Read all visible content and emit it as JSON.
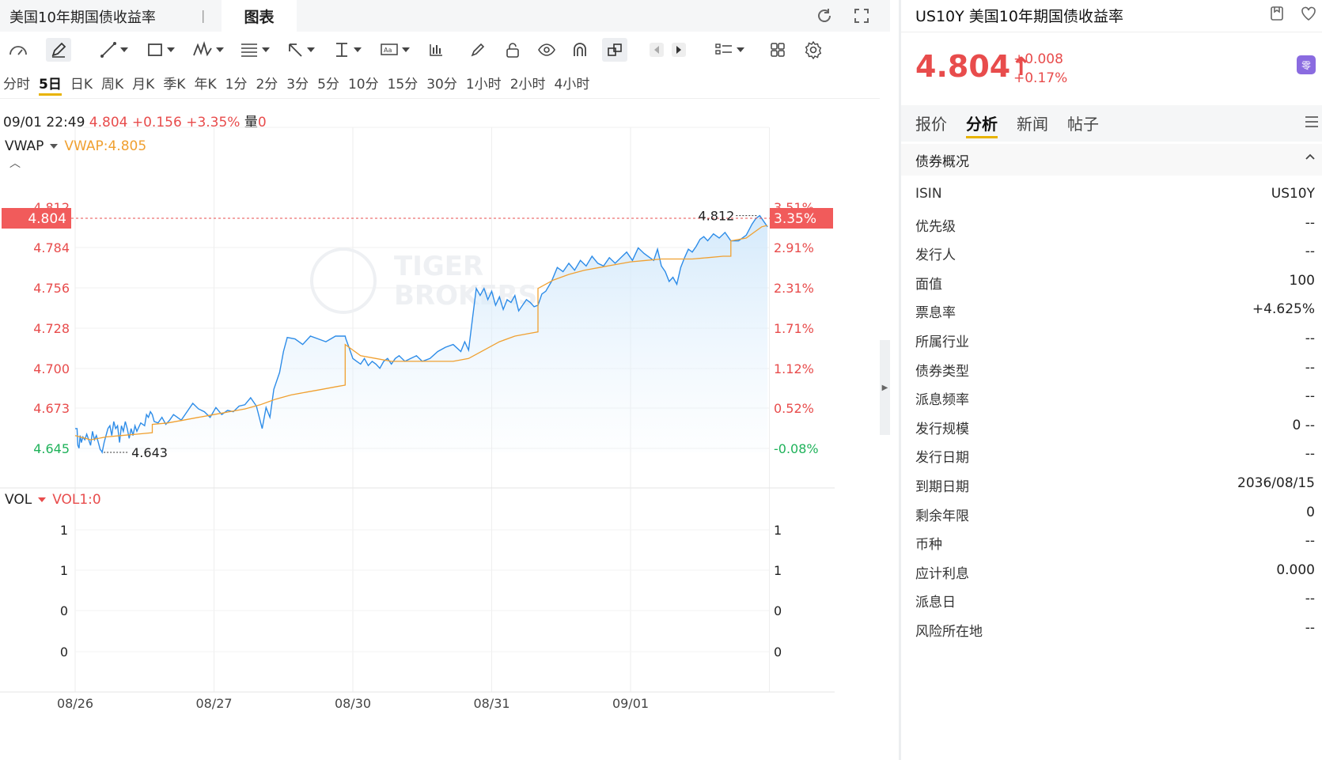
{
  "topbar": {
    "tab_name": "美国10年期国债收益率",
    "sep": "|",
    "chart_tab": "图表"
  },
  "periods": [
    "分时",
    "5日",
    "日K",
    "周K",
    "月K",
    "季K",
    "年K",
    "1分",
    "2分",
    "3分",
    "5分",
    "10分",
    "15分",
    "30分",
    "1小时",
    "2小时",
    "4小时"
  ],
  "active_period": "5日",
  "info_line": {
    "datetime": "09/01 22:49",
    "price": "4.804",
    "change": "+0.156",
    "change_pct": "+3.35%",
    "vol_label": "量",
    "vol_value": "0"
  },
  "indicators": {
    "vwap_label": "VWAP",
    "vwap_value": "VWAP:4.805",
    "vol_label": "VOL",
    "vol_value": "VOL1:0"
  },
  "watermark": {
    "line1": "TIGER",
    "line2": "BROKERS"
  },
  "chart_data": {
    "type": "line",
    "x_labels": [
      "08/26",
      "08/27",
      "08/30",
      "08/31",
      "09/01"
    ],
    "y_ticks": [
      "4.812",
      "4.784",
      "4.756",
      "4.728",
      "4.700",
      "4.673",
      "4.645"
    ],
    "pct_ticks": [
      "3.51%",
      "2.91%",
      "2.31%",
      "1.71%",
      "1.12%",
      "0.52%",
      "-0.08%"
    ],
    "last_price_label": "4.804",
    "last_pct_label": "3.35%",
    "high_label": "4.812",
    "low_label": "4.643",
    "ylim": [
      4.643,
      4.818
    ],
    "price_series": [
      [
        0.0,
        4.66
      ],
      [
        0.05,
        4.66
      ],
      [
        0.07,
        4.648
      ],
      [
        0.1,
        4.646
      ],
      [
        0.13,
        4.655
      ],
      [
        0.16,
        4.65
      ],
      [
        0.2,
        4.654
      ],
      [
        0.25,
        4.652
      ],
      [
        0.3,
        4.656
      ],
      [
        0.35,
        4.652
      ],
      [
        0.4,
        4.648
      ],
      [
        0.45,
        4.658
      ],
      [
        0.5,
        4.652
      ],
      [
        0.55,
        4.655
      ],
      [
        0.6,
        4.65
      ],
      [
        0.65,
        4.645
      ],
      [
        0.68,
        4.644
      ],
      [
        0.7,
        4.643
      ],
      [
        0.75,
        4.65
      ],
      [
        0.8,
        4.655
      ],
      [
        0.85,
        4.66
      ],
      [
        0.9,
        4.662
      ],
      [
        0.95,
        4.655
      ],
      [
        1.0,
        4.665
      ],
      [
        1.05,
        4.66
      ],
      [
        1.1,
        4.662
      ],
      [
        1.15,
        4.65
      ],
      [
        1.2,
        4.662
      ],
      [
        1.25,
        4.658
      ],
      [
        1.3,
        4.665
      ],
      [
        1.35,
        4.66
      ],
      [
        1.4,
        4.653
      ],
      [
        1.45,
        4.66
      ],
      [
        1.5,
        4.655
      ],
      [
        1.55,
        4.662
      ],
      [
        1.6,
        4.658
      ],
      [
        1.7,
        4.664
      ],
      [
        1.8,
        4.662
      ],
      [
        1.85,
        4.67
      ],
      [
        1.9,
        4.668
      ],
      [
        1.95,
        4.672
      ],
      [
        2.0,
        4.67
      ],
      [
        2.05,
        4.665
      ],
      [
        2.15,
        4.664
      ],
      [
        2.25,
        4.668
      ],
      [
        2.35,
        4.663
      ],
      [
        2.45,
        4.666
      ],
      [
        2.55,
        4.67
      ],
      [
        2.65,
        4.668
      ],
      [
        2.75,
        4.666
      ],
      [
        2.9,
        4.672
      ],
      [
        3.05,
        4.678
      ],
      [
        3.2,
        4.674
      ],
      [
        3.35,
        4.672
      ],
      [
        3.5,
        4.668
      ],
      [
        3.65,
        4.675
      ],
      [
        3.8,
        4.67
      ],
      [
        3.95,
        4.673
      ],
      [
        4.1,
        4.672
      ],
      [
        4.25,
        4.676
      ],
      [
        4.4,
        4.677
      ],
      [
        4.55,
        4.682
      ],
      [
        4.7,
        4.676
      ],
      [
        4.85,
        4.66
      ],
      [
        4.95,
        4.675
      ],
      [
        5.05,
        4.668
      ],
      [
        5.15,
        4.688
      ],
      [
        5.3,
        4.7
      ],
      [
        5.4,
        4.715
      ],
      [
        5.5,
        4.725
      ],
      [
        5.7,
        4.724
      ],
      [
        5.9,
        4.72
      ],
      [
        6.1,
        4.726
      ],
      [
        6.3,
        4.724
      ],
      [
        6.5,
        4.722
      ],
      [
        6.75,
        4.726
      ],
      [
        7.0,
        4.726
      ],
      [
        7.02,
        4.724
      ],
      [
        7.1,
        4.718
      ],
      [
        7.2,
        4.71
      ],
      [
        7.3,
        4.708
      ],
      [
        7.4,
        4.706
      ],
      [
        7.5,
        4.71
      ],
      [
        7.6,
        4.705
      ],
      [
        7.7,
        4.708
      ],
      [
        7.8,
        4.706
      ],
      [
        7.9,
        4.703
      ],
      [
        8.0,
        4.708
      ],
      [
        8.1,
        4.71
      ],
      [
        8.2,
        4.706
      ],
      [
        8.3,
        4.71
      ],
      [
        8.4,
        4.712
      ],
      [
        8.55,
        4.708
      ],
      [
        8.7,
        4.71
      ],
      [
        8.85,
        4.712
      ],
      [
        9.0,
        4.708
      ],
      [
        9.2,
        4.71
      ],
      [
        9.4,
        4.715
      ],
      [
        9.6,
        4.718
      ],
      [
        9.8,
        4.72
      ],
      [
        10.0,
        4.715
      ],
      [
        10.1,
        4.722
      ],
      [
        10.2,
        4.716
      ],
      [
        10.3,
        4.738
      ],
      [
        10.4,
        4.76
      ],
      [
        10.5,
        4.755
      ],
      [
        10.6,
        4.76
      ],
      [
        10.7,
        4.752
      ],
      [
        10.8,
        4.758
      ],
      [
        10.9,
        4.748
      ],
      [
        11.0,
        4.754
      ],
      [
        11.1,
        4.745
      ],
      [
        11.2,
        4.752
      ],
      [
        11.3,
        4.75
      ],
      [
        11.4,
        4.755
      ],
      [
        11.5,
        4.744
      ],
      [
        11.6,
        4.748
      ],
      [
        11.7,
        4.752
      ],
      [
        11.8,
        4.75
      ],
      [
        11.9,
        4.747
      ],
      [
        12.0,
        4.748
      ],
      [
        12.1,
        4.756
      ],
      [
        12.2,
        4.758
      ],
      [
        12.35,
        4.765
      ],
      [
        12.5,
        4.775
      ],
      [
        12.65,
        4.772
      ],
      [
        12.8,
        4.778
      ],
      [
        12.95,
        4.773
      ],
      [
        13.1,
        4.78
      ],
      [
        13.25,
        4.776
      ],
      [
        13.4,
        4.783
      ],
      [
        13.55,
        4.778
      ],
      [
        13.7,
        4.776
      ],
      [
        13.85,
        4.782
      ],
      [
        14.0,
        4.778
      ],
      [
        14.15,
        4.782
      ],
      [
        14.3,
        4.786
      ],
      [
        14.45,
        4.78
      ],
      [
        14.6,
        4.789
      ],
      [
        14.75,
        4.785
      ],
      [
        14.9,
        4.782
      ],
      [
        15.0,
        4.78
      ],
      [
        15.1,
        4.788
      ],
      [
        15.2,
        4.776
      ],
      [
        15.3,
        4.772
      ],
      [
        15.4,
        4.765
      ],
      [
        15.5,
        4.768
      ],
      [
        15.6,
        4.763
      ],
      [
        15.7,
        4.775
      ],
      [
        15.8,
        4.782
      ],
      [
        15.9,
        4.788
      ],
      [
        16.0,
        4.786
      ],
      [
        16.1,
        4.79
      ],
      [
        16.2,
        4.795
      ],
      [
        16.3,
        4.797
      ],
      [
        16.4,
        4.794
      ],
      [
        16.55,
        4.799
      ],
      [
        16.7,
        4.796
      ],
      [
        16.85,
        4.8
      ],
      [
        17.0,
        4.794
      ],
      [
        17.2,
        4.794
      ],
      [
        17.4,
        4.798
      ],
      [
        17.55,
        4.806
      ],
      [
        17.65,
        4.81
      ],
      [
        17.75,
        4.812
      ],
      [
        17.85,
        4.808
      ],
      [
        17.95,
        4.804
      ]
    ],
    "vwap_series": [
      [
        0.0,
        4.655
      ],
      [
        0.4,
        4.652
      ],
      [
        0.8,
        4.654
      ],
      [
        1.2,
        4.655
      ],
      [
        1.6,
        4.656
      ],
      [
        2.0,
        4.657
      ],
      [
        2.0,
        4.663
      ],
      [
        2.4,
        4.664
      ],
      [
        2.8,
        4.666
      ],
      [
        3.2,
        4.668
      ],
      [
        3.6,
        4.67
      ],
      [
        4.0,
        4.672
      ],
      [
        4.4,
        4.674
      ],
      [
        4.8,
        4.677
      ],
      [
        5.2,
        4.681
      ],
      [
        5.6,
        4.684
      ],
      [
        6.0,
        4.686
      ],
      [
        6.4,
        4.688
      ],
      [
        6.8,
        4.69
      ],
      [
        7.0,
        4.691
      ],
      [
        7.0,
        4.72
      ],
      [
        7.4,
        4.712
      ],
      [
        7.8,
        4.71
      ],
      [
        8.2,
        4.708
      ],
      [
        8.6,
        4.708
      ],
      [
        9.0,
        4.708
      ],
      [
        9.4,
        4.708
      ],
      [
        9.8,
        4.708
      ],
      [
        10.2,
        4.71
      ],
      [
        10.6,
        4.716
      ],
      [
        11.0,
        4.722
      ],
      [
        11.4,
        4.726
      ],
      [
        11.8,
        4.728
      ],
      [
        12.0,
        4.729
      ],
      [
        12.0,
        4.76
      ],
      [
        12.4,
        4.766
      ],
      [
        12.8,
        4.77
      ],
      [
        13.2,
        4.773
      ],
      [
        13.6,
        4.775
      ],
      [
        14.0,
        4.777
      ],
      [
        14.4,
        4.779
      ],
      [
        14.8,
        4.78
      ],
      [
        15.2,
        4.781
      ],
      [
        15.6,
        4.781
      ],
      [
        16.0,
        4.781
      ],
      [
        16.4,
        4.782
      ],
      [
        16.8,
        4.783
      ],
      [
        17.0,
        4.783
      ],
      [
        17.0,
        4.794
      ],
      [
        17.4,
        4.796
      ],
      [
        17.6,
        4.8
      ],
      [
        17.8,
        4.804
      ],
      [
        17.95,
        4.805
      ]
    ]
  },
  "vol_chart": {
    "y_ticks_left": [
      "1",
      "1",
      "0",
      "0"
    ],
    "y_ticks_right": [
      "1",
      "1",
      "0",
      "0"
    ]
  },
  "right": {
    "symbol": "US10Y",
    "name": "美国10年期国债收益率",
    "price": "4.804",
    "arrow": "↑",
    "change": "+0.008",
    "change_pct": "+0.17%",
    "badge": "零",
    "tabs": [
      "报价",
      "分析",
      "新闻",
      "帖子"
    ],
    "active_tab": "分析",
    "section_title": "债券概况",
    "rows": [
      {
        "k": "ISIN",
        "v": "US10Y"
      },
      {
        "k": "优先级",
        "v": "--"
      },
      {
        "k": "发行人",
        "v": "--"
      },
      {
        "k": "面值",
        "v": "100"
      },
      {
        "k": "票息率",
        "v": "+4.625%"
      },
      {
        "k": "所属行业",
        "v": "--"
      },
      {
        "k": "债券类型",
        "v": "--"
      },
      {
        "k": "派息频率",
        "v": "--"
      },
      {
        "k": "发行规模",
        "v": "0 --"
      },
      {
        "k": "发行日期",
        "v": "--"
      },
      {
        "k": "到期日期",
        "v": "2036/08/15"
      },
      {
        "k": "剩余年限",
        "v": "0"
      },
      {
        "k": "币种",
        "v": "--"
      },
      {
        "k": "应计利息",
        "v": "0.000"
      },
      {
        "k": "派息日",
        "v": "--"
      },
      {
        "k": "风险所在地",
        "v": "--"
      }
    ]
  },
  "colors": {
    "up_red": "#e84c4c",
    "down_green": "#1fb25a",
    "line_blue": "#2d8ce8",
    "vwap_orange": "#f0a030",
    "accent": "#e8b300"
  }
}
